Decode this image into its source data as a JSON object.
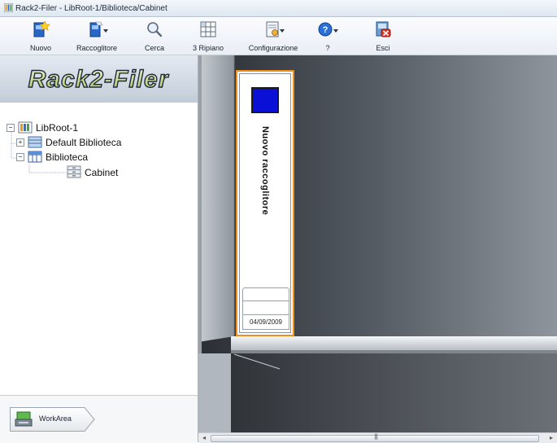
{
  "window": {
    "title": "Rack2-Filer - LibRoot-1/Biblioteca/Cabinet",
    "icon": "rack2-filer-app-icon"
  },
  "toolbar": {
    "buttons": [
      {
        "label": "Nuovo",
        "icon": "new-binder-icon",
        "dropdown": false
      },
      {
        "label": "Raccoglitore",
        "icon": "binder-icon",
        "dropdown": true
      },
      {
        "label": "Cerca",
        "icon": "search-icon",
        "dropdown": false
      },
      {
        "label": "3 Ripiano",
        "icon": "shelf-grid-icon",
        "dropdown": false
      },
      {
        "label": "Configurazione",
        "icon": "configuration-icon",
        "dropdown": true
      },
      {
        "label": "?",
        "icon": "help-icon",
        "dropdown": true
      },
      {
        "label": "Esci",
        "icon": "exit-icon",
        "dropdown": false
      }
    ]
  },
  "sidebar": {
    "logo_text": "Rack2-Filer",
    "tree": {
      "root": {
        "label": "LibRoot-1",
        "icon": "library-root-icon",
        "expanded": true
      },
      "libraries": [
        {
          "label": "Default Biblioteca",
          "icon": "library-icon",
          "expanded": false
        },
        {
          "label": "Biblioteca",
          "icon": "library-icon",
          "expanded": true
        }
      ],
      "cabinet": {
        "label": "Cabinet",
        "icon": "cabinet-icon",
        "selected": true
      }
    },
    "workarea": {
      "label": "WorkArea",
      "icon": "workarea-icon"
    }
  },
  "shelf": {
    "binder": {
      "title": "Nuovo raccoglitore",
      "date": "04/09/2009",
      "color": "#0a10d6",
      "border_color": "#f0901a"
    }
  },
  "colors": {
    "accent": "#f0901a",
    "binder_label": "#0a10d6"
  }
}
